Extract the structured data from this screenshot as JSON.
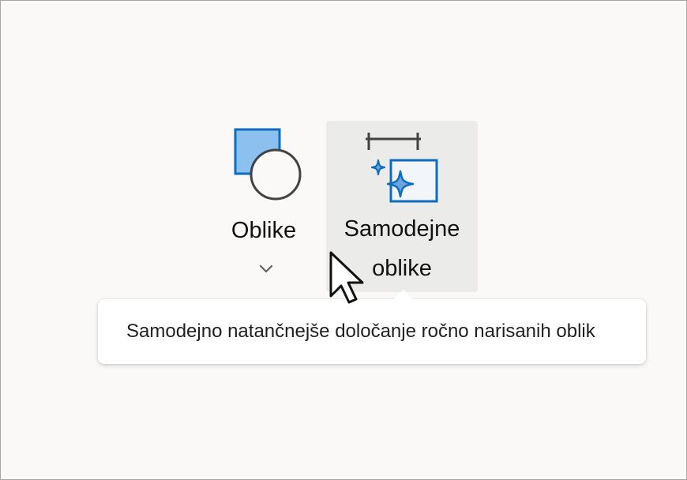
{
  "ribbon": {
    "shapes_button": {
      "label": "Oblike",
      "icon": "shapes-icon",
      "dropdown_icon": "chevron-down-icon"
    },
    "auto_shapes_button": {
      "label_line1": "Samodejne",
      "label_line2": "oblike",
      "icon": "auto-shapes-icon",
      "state": "hover"
    }
  },
  "tooltip": {
    "text": "Samodejno natančnejše določanje ročno narisanih oblik"
  },
  "colors": {
    "frame_background": "#faf9f8",
    "hover_background": "#ebebea",
    "icon_blue": "#0f6cbd",
    "icon_blue_fill": "#8cc0ee",
    "icon_dark": "#424242"
  }
}
